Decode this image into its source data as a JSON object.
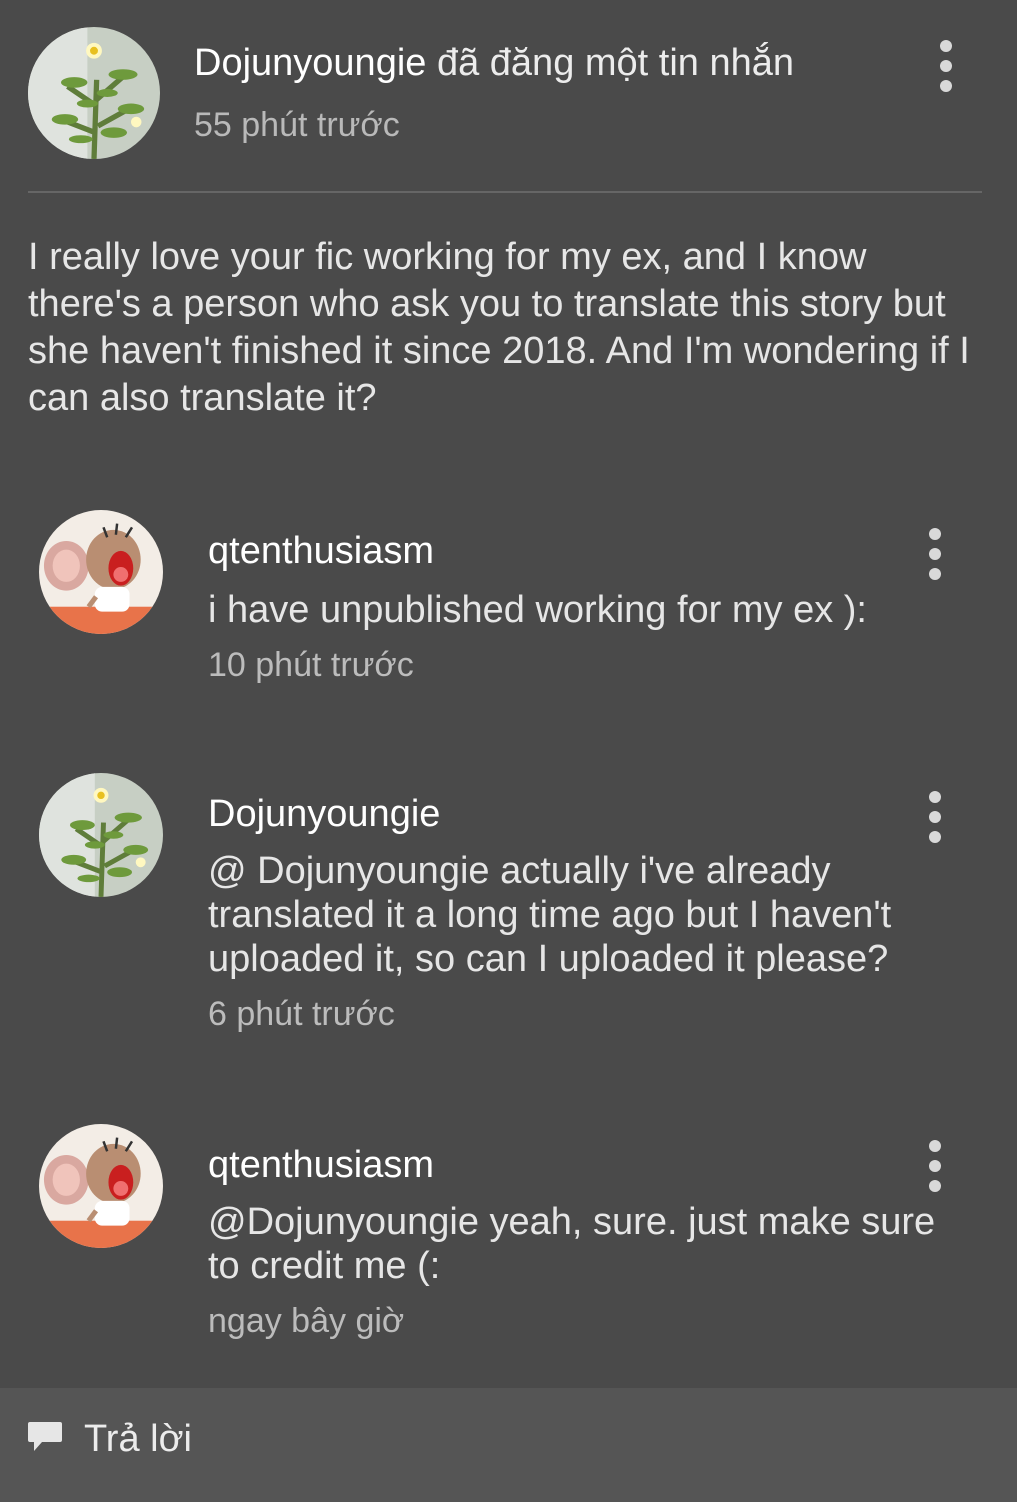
{
  "post": {
    "author": "Dojunyoungie",
    "action": " đã đăng một tin nhắn",
    "time": "55 phút trước",
    "body": "I really love your fic working for my ex, and I know there's a person who ask you to translate this story but she haven't finished it since 2018. And I'm wondering if I can also translate it?"
  },
  "comments": [
    {
      "name": "qtenthusiasm",
      "text": "i have unpublished working for my ex ):",
      "time": "10 phút trước"
    },
    {
      "name": "Dojunyoungie",
      "text": "@ Dojunyoungie  actually i've already translated it a long time ago but I haven't uploaded it, so can I uploaded it please?",
      "time": "6 phút trước"
    },
    {
      "name": "qtenthusiasm",
      "text": "@Dojunyoungie yeah, sure. just make sure to credit me (:",
      "time": "ngay bây giờ"
    }
  ],
  "reply": {
    "label": "Trả lời",
    "icon": "speech-bubble-icon"
  },
  "colors": {
    "background": "#4a4a4a",
    "reply_bar": "#555555",
    "secondary_text": "#b9b9b9"
  }
}
